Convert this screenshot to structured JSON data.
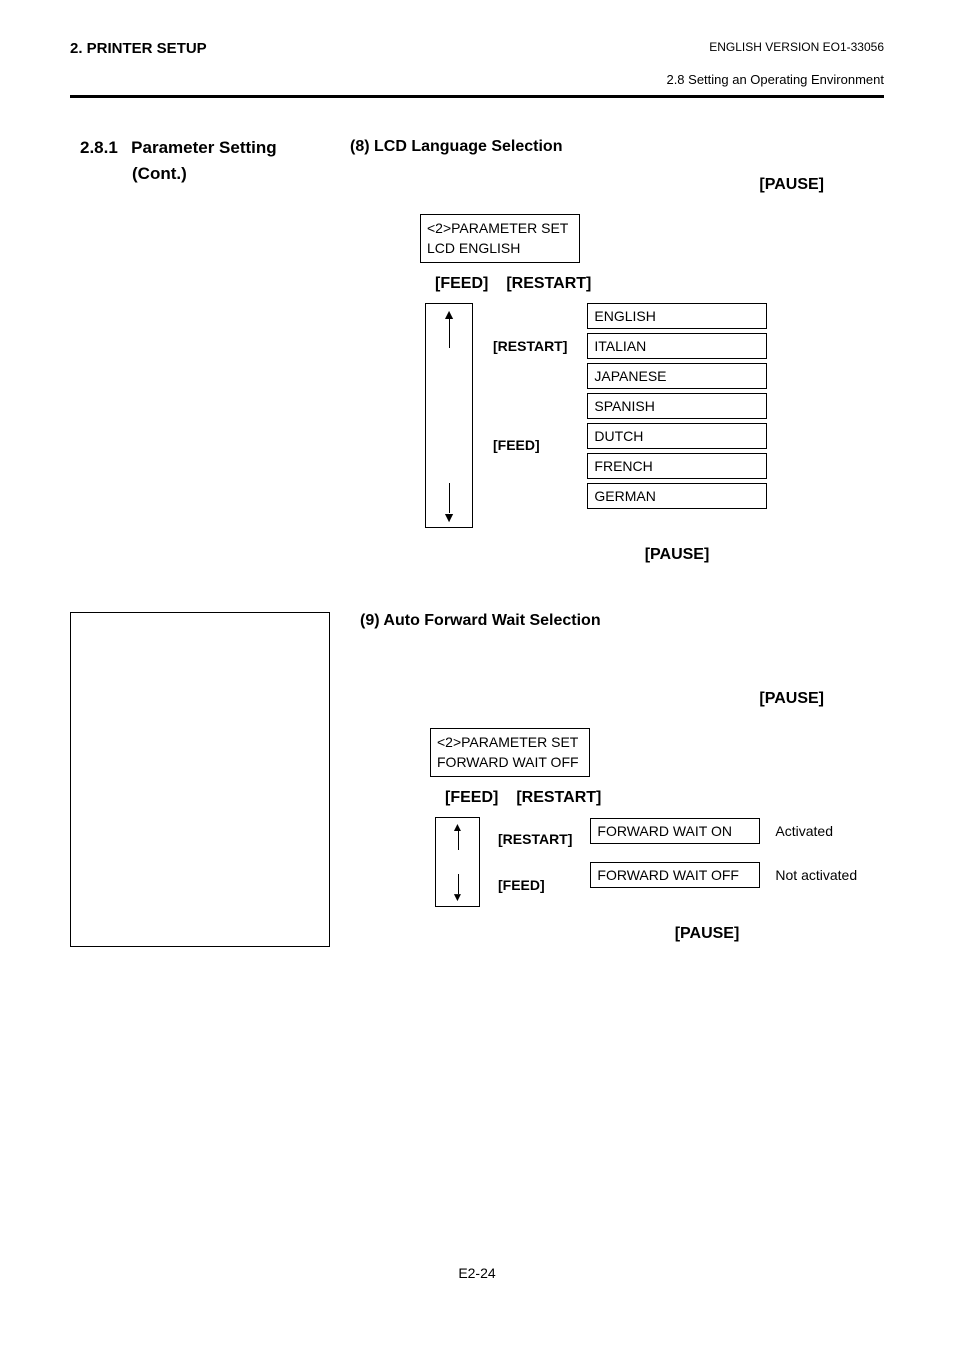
{
  "header": {
    "left": "2. PRINTER SETUP",
    "right1": "ENGLISH VERSION EO1-33056",
    "right2": "2.8 Setting an Operating Environment"
  },
  "section": {
    "num": "2.8.1",
    "title": "Parameter Setting",
    "cont": "(Cont.)"
  },
  "sub8": {
    "title": "(8)  LCD Language Selection",
    "pause": "[PAUSE]",
    "lcd_line1": "<2>PARAMETER SET",
    "lcd_line2": "LCD   ENGLISH",
    "feed": "[FEED]",
    "restart": "[RESTART]",
    "side_restart": "[RESTART]",
    "side_feed": "[FEED]",
    "languages": [
      "ENGLISH",
      "ITALIAN",
      "JAPANESE",
      "SPANISH",
      "DUTCH",
      "FRENCH",
      "GERMAN"
    ],
    "pause2": "[PAUSE]"
  },
  "sub9": {
    "title": "(9)  Auto Forward Wait Selection",
    "pause": "[PAUSE]",
    "lcd_line1": "<2>PARAMETER SET",
    "lcd_line2": "FORWARD WAIT OFF",
    "feed": "[FEED]",
    "restart": "[RESTART]",
    "side_restart": "[RESTART]",
    "side_feed": "[FEED]",
    "options": [
      {
        "box": "FORWARD WAIT ON",
        "label": "Activated"
      },
      {
        "box": "FORWARD WAIT OFF",
        "label": "Not activated"
      }
    ],
    "pause2": "[PAUSE]"
  },
  "footer": "E2-24"
}
